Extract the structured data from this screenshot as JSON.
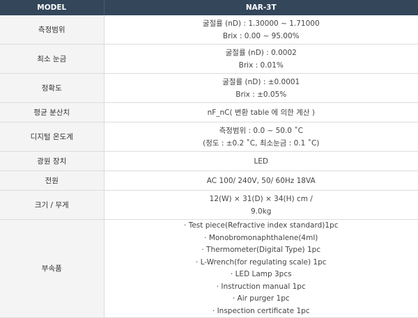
{
  "header": {
    "model_label": "MODEL",
    "model_value": "NAR-3T"
  },
  "rows": [
    {
      "label": "측정범위",
      "lines": [
        "굴절률 (nD) : 1.30000 ~ 1.71000",
        "Brix : 0.00 ~ 95.00%"
      ]
    },
    {
      "label": "최소 눈금",
      "lines": [
        "굴절률 (nD) : 0.0002",
        "Brix : 0.01%"
      ]
    },
    {
      "label": "정확도",
      "lines": [
        "굴절률 (nD) : ±0.0001",
        "Brix : ±0.05%"
      ]
    },
    {
      "label": "평균 분산치",
      "lines": [
        "nF_nC( 변환 table 에 의한 계산 )"
      ]
    },
    {
      "label": "디지털 온도계",
      "lines": [
        "측정범위 : 0.0 ~ 50.0 ˚C",
        "(정도 : ±0.2 ˚C, 최소눈금 : 0.1 ˚C)"
      ]
    },
    {
      "label": "광원 장치",
      "lines": [
        "LED"
      ]
    },
    {
      "label": "전원",
      "lines": [
        "AC 100/ 240V, 50/ 60Hz 18VA"
      ]
    },
    {
      "label": "크기 / 무게",
      "lines": [
        "12(W) × 31(D) × 34(H) cm /",
        "9.0kg"
      ]
    },
    {
      "label": "부속품",
      "lines": [
        "· Test piece(Refractive index standard)1pc",
        "· Monobromonaphthalene(4ml)",
        "· Thermometer(Digital Type) 1pc",
        "· L-Wrench(for regulating scale) 1pc",
        "· LED Lamp 3pcs",
        "· Instruction manual 1pc",
        "· Air purger 1pc",
        "· Inspection certificate 1pc"
      ]
    }
  ]
}
